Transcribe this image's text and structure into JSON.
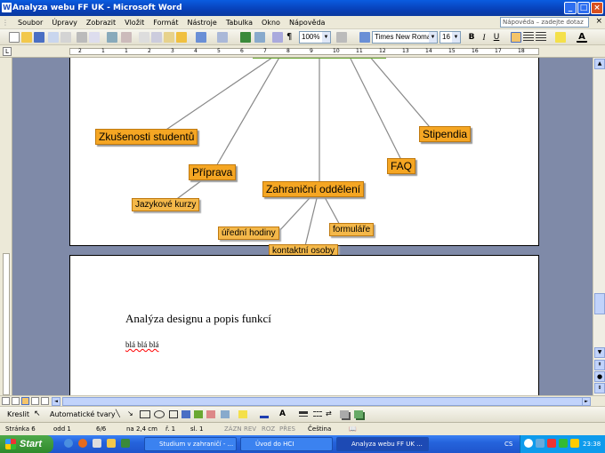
{
  "window": {
    "title": "Analyza webu FF UK - Microsoft Word"
  },
  "menu": {
    "items": [
      "Soubor",
      "Úpravy",
      "Zobrazit",
      "Vložit",
      "Formát",
      "Nástroje",
      "Tabulka",
      "Okno",
      "Nápověda"
    ],
    "help_placeholder": "Nápověda – zadejte dotaz"
  },
  "toolbar": {
    "zoom": "100%",
    "font": "Times New Roman",
    "size": "16"
  },
  "ruler": {
    "numbers": [
      "2",
      "1",
      "1",
      "2",
      "3",
      "4",
      "5",
      "6",
      "7",
      "8",
      "9",
      "10",
      "11",
      "12",
      "13",
      "14",
      "15",
      "16",
      "17",
      "18"
    ]
  },
  "diagram": {
    "nodes_main": [
      "Zkušenosti studentů",
      "Příprava",
      "Zahraniční oddělení",
      "FAQ",
      "Stipendia"
    ],
    "nodes_sub": [
      "Jazykové kurzy",
      "úřední hodiny",
      "kontaktní osoby",
      "formuláře"
    ]
  },
  "page2": {
    "heading": "Analýza designu a popis funkcí",
    "body": "blá blá blá"
  },
  "drawing": {
    "draw_label": "Kreslit",
    "autoshapes_label": "Automatické tvary"
  },
  "status": {
    "page": "Stránka 6",
    "section": "odd 1",
    "pages": "6/6",
    "at": "na 2,4 cm",
    "line": "ř. 1",
    "col": "sl. 1",
    "zazn": "ZÁZN",
    "rev": "REV",
    "roz": "ROZ",
    "pres": "PŘES",
    "language": "Čeština"
  },
  "taskbar": {
    "start_label": "Start",
    "tasks": [
      "Studium v zahraničí - ...",
      "Úvod do HCI",
      "Analyza webu FF UK ..."
    ],
    "lang": "CS",
    "clock": "23:38"
  }
}
